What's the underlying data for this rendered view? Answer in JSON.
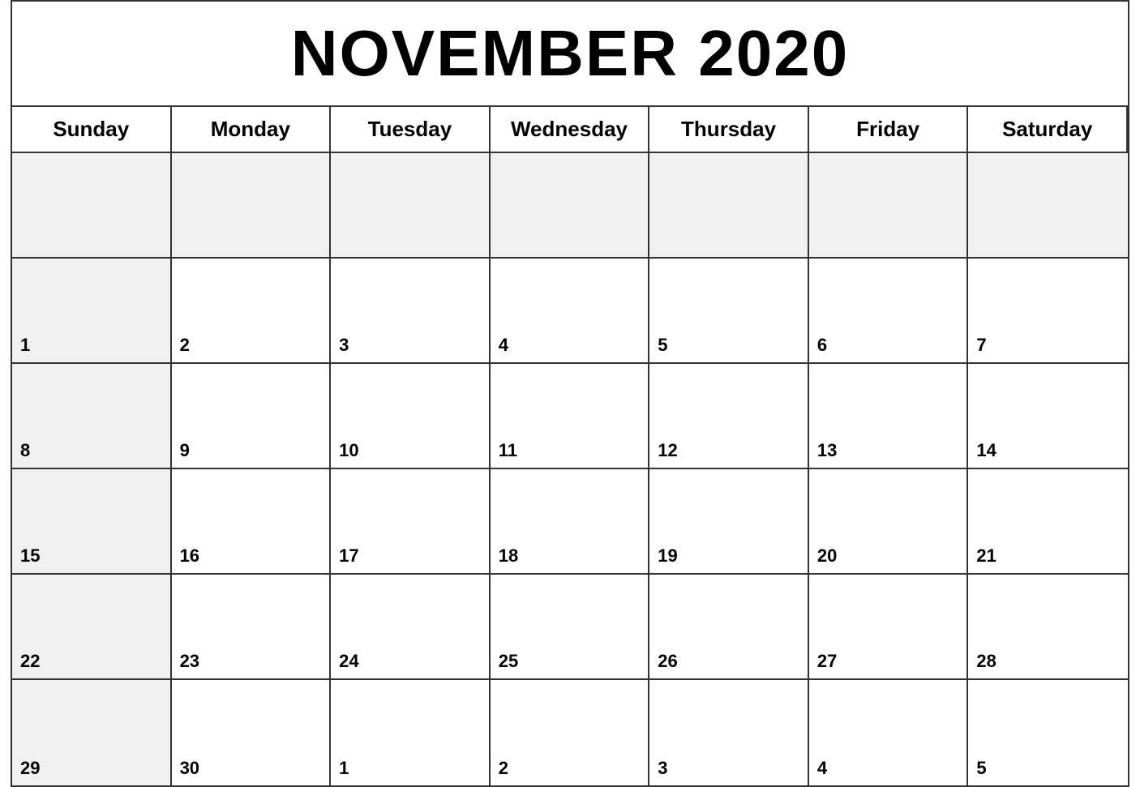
{
  "calendar": {
    "title": "NOVEMBER 2020",
    "days_of_week": [
      "Sunday",
      "Monday",
      "Tuesday",
      "Wednesday",
      "Thursday",
      "Friday",
      "Saturday"
    ],
    "weeks": [
      [
        {
          "date": "",
          "empty": true,
          "sunday": true
        },
        {
          "date": "",
          "empty": true
        },
        {
          "date": "",
          "empty": true
        },
        {
          "date": "",
          "empty": true
        },
        {
          "date": "",
          "empty": true
        },
        {
          "date": "",
          "empty": true
        },
        {
          "date": "",
          "empty": true
        }
      ],
      [
        {
          "date": "1",
          "sunday": true
        },
        {
          "date": "2"
        },
        {
          "date": "3"
        },
        {
          "date": "4"
        },
        {
          "date": "5"
        },
        {
          "date": "6"
        },
        {
          "date": "7"
        }
      ],
      [
        {
          "date": "8",
          "sunday": true
        },
        {
          "date": "9"
        },
        {
          "date": "10"
        },
        {
          "date": "11"
        },
        {
          "date": "12"
        },
        {
          "date": "13"
        },
        {
          "date": "14"
        }
      ],
      [
        {
          "date": "15",
          "sunday": true
        },
        {
          "date": "16"
        },
        {
          "date": "17"
        },
        {
          "date": "18"
        },
        {
          "date": "19"
        },
        {
          "date": "20"
        },
        {
          "date": "21"
        }
      ],
      [
        {
          "date": "22",
          "sunday": true
        },
        {
          "date": "23"
        },
        {
          "date": "24"
        },
        {
          "date": "25"
        },
        {
          "date": "26"
        },
        {
          "date": "27"
        },
        {
          "date": "28"
        }
      ],
      [
        {
          "date": "29",
          "sunday": true
        },
        {
          "date": "30"
        },
        {
          "date": "1",
          "overflow": true
        },
        {
          "date": "2",
          "overflow": true
        },
        {
          "date": "3",
          "overflow": true
        },
        {
          "date": "4",
          "overflow": true
        },
        {
          "date": "5",
          "overflow": true
        }
      ]
    ]
  }
}
